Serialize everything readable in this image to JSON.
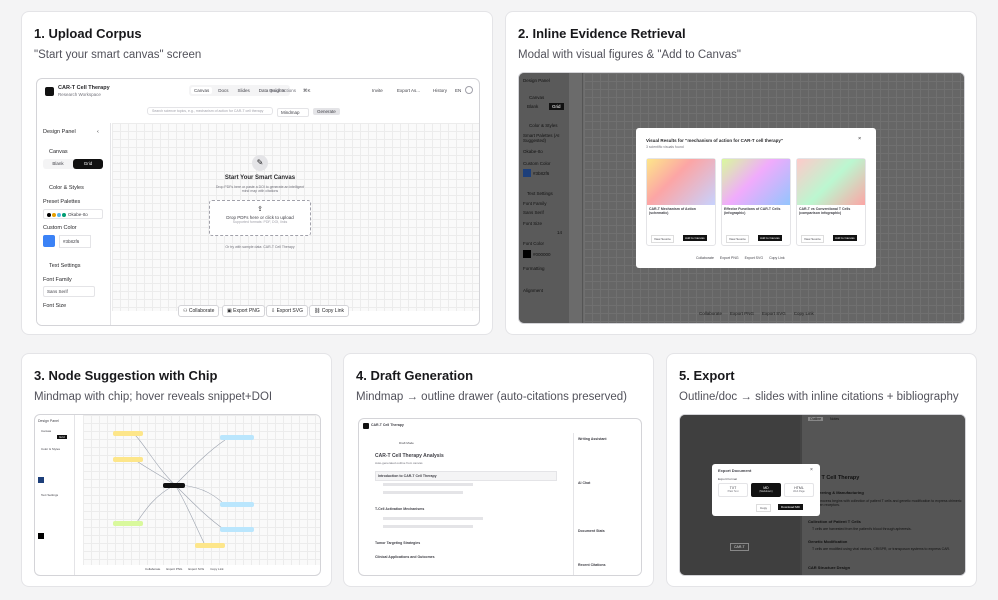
{
  "cards": [
    {
      "title": "1. Upload Corpus",
      "subtitle": "\"Start your smart canvas\" screen"
    },
    {
      "title": "2. Inline Evidence Retrieval",
      "subtitle": "Modal with visual figures & \"Add to Canvas\""
    },
    {
      "title": "3. Node Suggestion with Chip",
      "subtitle": "Mindmap with chip; hover reveals snippet+DOI"
    },
    {
      "title": "4. Draft Generation",
      "subtitle": "Mindmap → outline drawer (auto-citations preserved)"
    },
    {
      "title": "5. Export",
      "subtitle": "Outline/doc → slides with inline citations + bibliography"
    }
  ],
  "app": {
    "name": "CAR-T Cell Therapy",
    "workspace": "Research Workspace",
    "tabs": [
      "Canvas",
      "Docs",
      "Slides",
      "Data Insights"
    ],
    "quick_actions": "Quick actions",
    "kbd": "⌘K",
    "invite": "Invite",
    "export_as": "Export As...",
    "history": "History",
    "en": "EN",
    "search_placeholder": "Search science topics, e.g., mechanism of action for CAR-T cell therapy",
    "mode": "Mindmap",
    "generate": "Generate"
  },
  "design_panel": {
    "title": "Design Panel",
    "canvas_label": "Canvas",
    "blank": "Blank",
    "grid": "Grid",
    "color_styles": "Color & Styles",
    "preset_palettes": "Preset Palettes",
    "preset_palettes_ai": "Smart Palettes (AI Suggested)",
    "palette_value": "Okabe-Ito",
    "custom_color": "Custom Color",
    "custom_hex": "#3b82f6",
    "text_settings": "Text Settings",
    "font_family": "Font Family",
    "font_value": "Sans Serif",
    "font_size": "Font Size",
    "font_size_value": "14",
    "font_color": "Font Color",
    "font_color_value": "#000000",
    "formatting": "Formatting",
    "alignment": "Alignment",
    "colors": {
      "accent": "#3b82f6",
      "palette": [
        "#000000",
        "#e69f00",
        "#56b4e9",
        "#009e73",
        "#f0e442"
      ]
    }
  },
  "upload": {
    "heading": "Start Your Smart Canvas",
    "desc": "Drop PDFs here or paste a DOI to generate an intelligent mind map with citations",
    "drop_text": "Drop PDFs here or click to upload",
    "drop_sub": "Supported formats: PDF, DOI, links",
    "sample": "Or try with sample data: CAR-T Cell Therapy"
  },
  "bottom_actions": [
    "Collaborate",
    "Export PNG",
    "Export SVG",
    "Copy Link"
  ],
  "modal": {
    "title": "Visual Results for \"mechanism of action for CAR-T cell therapy\"",
    "sub": "3 scientific visuals found",
    "figures": [
      {
        "title": "CAR-T Mechanism of Action (schematic)",
        "view": "View Source",
        "add": "Add to Canvas"
      },
      {
        "title": "Effector Functions of CAR-T Cells (infographic)",
        "view": "View Source",
        "add": "Add to Canvas"
      },
      {
        "title": "CAR-T vs Conventional T Cells (comparison infographic)",
        "view": "View Source",
        "add": "Add to Canvas"
      }
    ]
  },
  "draft": {
    "doc_title": "CAR-T Cell Therapy Analysis",
    "doc_sub": "Auto-generated outline from canvas",
    "intro": "Introduction to CAR-T Cell Therapy",
    "activation": "T-Cell Activation Mechanisms",
    "tumor": "Tumor Targeting Strategies",
    "clinical": "Clinical Applications and Outcomes",
    "assistant": "Writing Assistant",
    "ai_chat": "AI Chat",
    "doc_stats": "Document Stats",
    "recent": "Recent Citations",
    "draft_tab": "Draft Mode"
  },
  "export": {
    "title": "Export Document",
    "format_label": "Export Format",
    "formats": [
      {
        "name": "TXT",
        "sub": "Plain Text"
      },
      {
        "name": "MD",
        "sub": "(Markdown)"
      },
      {
        "name": "HTML",
        "sub": "Web Page"
      }
    ],
    "copy": "Copy",
    "download": "Download MD",
    "doc_heading": "CAR T Cell Therapy",
    "engineering": "Engineering & Manufacturing",
    "collection": "Collection of Patient T Cells",
    "genetic": "Genetic Modification",
    "car_structure": "CAR Structure Design",
    "outline_tab": "Outline",
    "notes_tab": "Notes",
    "hub": "CAR-T",
    "bullet1": "The process begins with collection of patient T cells and genetic modification to express chimeric antigen receptors.",
    "bullet2": "T cells are harvested from the patient's blood through apheresis.",
    "bullet3": "T cells are modified using viral vectors, CRISPR, or transposon systems to express CAR."
  }
}
